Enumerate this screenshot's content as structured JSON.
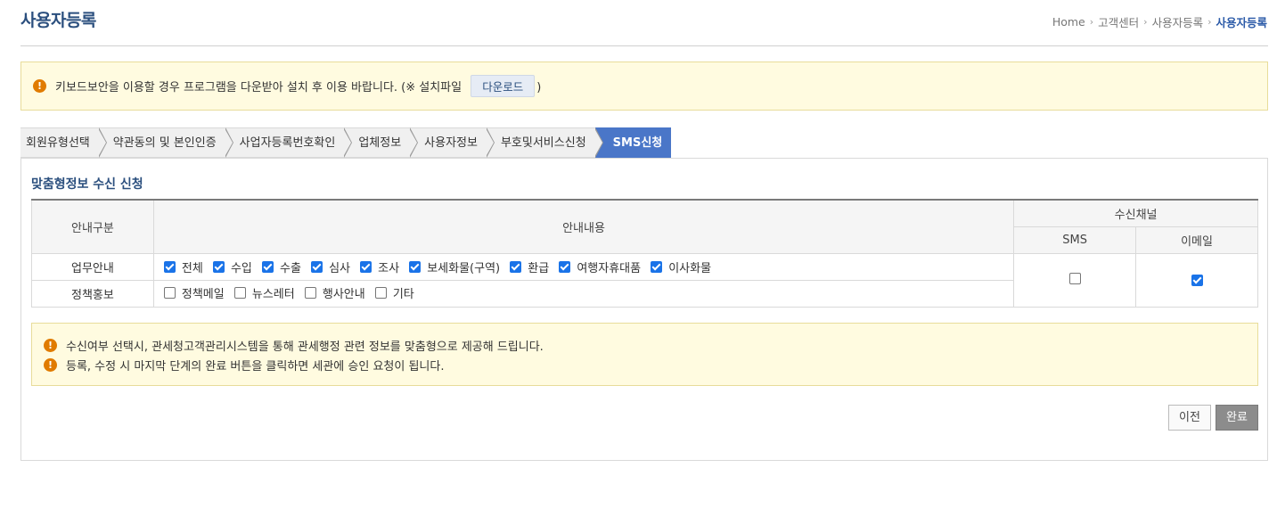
{
  "header": {
    "title": "사용자등록",
    "breadcrumb": [
      "Home",
      "고객센터",
      "사용자등록",
      "사용자등록"
    ]
  },
  "top_notice": {
    "text": "키보드보안을 이용할 경우 프로그램을 다운받아 설치 후 이용 바랍니다. (※ 설치파일",
    "download_label": "다운로드",
    "suffix": ")"
  },
  "steps": [
    "회원유형선택",
    "약관동의 및 본인인증",
    "사업자등록번호확인",
    "업체정보",
    "사용자정보",
    "부호및서비스신청",
    "SMS신청"
  ],
  "section_title": "맞춤형정보 수신 신청",
  "table": {
    "headers": {
      "category": "안내구분",
      "content": "안내내용",
      "channel": "수신채널",
      "sms": "SMS",
      "email": "이메일"
    },
    "rows": [
      {
        "label": "업무안내",
        "options": [
          {
            "label": "전체",
            "checked": true
          },
          {
            "label": "수입",
            "checked": true
          },
          {
            "label": "수출",
            "checked": true
          },
          {
            "label": "심사",
            "checked": true
          },
          {
            "label": "조사",
            "checked": true
          },
          {
            "label": "보세화물(구역)",
            "checked": true
          },
          {
            "label": "환급",
            "checked": true
          },
          {
            "label": "여행자휴대품",
            "checked": true
          },
          {
            "label": "이사화물",
            "checked": true
          }
        ]
      },
      {
        "label": "정책홍보",
        "options": [
          {
            "label": "정책메일",
            "checked": false
          },
          {
            "label": "뉴스레터",
            "checked": false
          },
          {
            "label": "행사안내",
            "checked": false
          },
          {
            "label": "기타",
            "checked": false
          }
        ]
      }
    ],
    "channel_sms_checked": false,
    "channel_email_checked": true
  },
  "bottom_notice": [
    "수신여부 선택시, 관세청고객관리시스템을 통해 관세행정 관련 정보를 맞춤형으로 제공해 드립니다.",
    "등록, 수정 시 마지막 단계의 완료 버튼을 클릭하면 세관에 승인 요청이 됩니다."
  ],
  "buttons": {
    "prev": "이전",
    "done": "완료"
  },
  "icons": {
    "warning": "exclamation-circle-icon",
    "breadcrumb_sep": "chevron-right-icon"
  },
  "colors": {
    "title": "#2b4f7e",
    "active_step": "#4a76c8",
    "notice_bg": "#fffbe0",
    "warning_icon": "#e07b00",
    "checkbox": "#1a73e8"
  }
}
